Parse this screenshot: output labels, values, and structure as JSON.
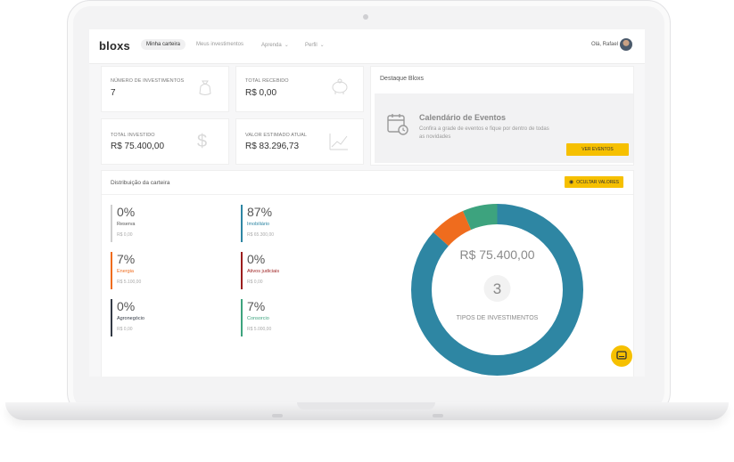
{
  "nav": {
    "logo": "bloxs",
    "items": [
      "Minha carteira",
      "Meus investimentos",
      "Aprenda",
      "Perfil"
    ],
    "user": "Olá, Rafael"
  },
  "cards": {
    "num_investimentos": {
      "label": "NÚMERO DE INVESTIMENTOS",
      "value": "7"
    },
    "total_recebido": {
      "label": "TOTAL RECEBIDO",
      "value": "R$ 0,00"
    },
    "total_investido": {
      "label": "TOTAL INVESTIDO",
      "value": "R$ 75.400,00"
    },
    "valor_estimado": {
      "label": "VALOR ESTIMADO ATUAL",
      "value": "R$ 83.296,73"
    }
  },
  "destaque": {
    "title": "Destaque Bloxs",
    "event_title": "Calendário de Eventos",
    "event_text": "Confira a grade de eventos e fique por dentro de todas as novidades",
    "button": "VER EVENTOS"
  },
  "distribution": {
    "title": "Distribuição da carteira",
    "hide_button": "OCULTAR VALORES",
    "items": [
      {
        "pct": "0%",
        "name": "Reserva",
        "value": "R$ 0,00",
        "color": "#cfcfcf",
        "name_color": "#555555"
      },
      {
        "pct": "87%",
        "name": "Imobiliário",
        "value": "R$ 65.300,00",
        "color": "#2e86a3",
        "name_color": "#2e86a3"
      },
      {
        "pct": "7%",
        "name": "Energia",
        "value": "R$ 5.100,00",
        "color": "#ef6c1e",
        "name_color": "#ef6c1e"
      },
      {
        "pct": "0%",
        "name": "Ativos judiciais",
        "value": "R$ 0,00",
        "color": "#9b1c1c",
        "name_color": "#9b1c1c"
      },
      {
        "pct": "0%",
        "name": "Agronegócio",
        "value": "R$ 0,00",
        "color": "#333a45",
        "name_color": "#333a45"
      },
      {
        "pct": "7%",
        "name": "Consorcio",
        "value": "R$ 5.000,00",
        "color": "#3da37e",
        "name_color": "#3da37e"
      }
    ],
    "donut": {
      "total": "R$ 75.400,00",
      "count": "3",
      "caption": "TIPOS DE INVESTIMENTOS",
      "segments": [
        {
          "name": "Imobiliário",
          "percent": 87,
          "color": "#2e86a3"
        },
        {
          "name": "Energia",
          "percent": 6.8,
          "color": "#ef6c1e"
        },
        {
          "name": "Consorcio",
          "percent": 6.6,
          "color": "#3da37e"
        }
      ]
    }
  }
}
